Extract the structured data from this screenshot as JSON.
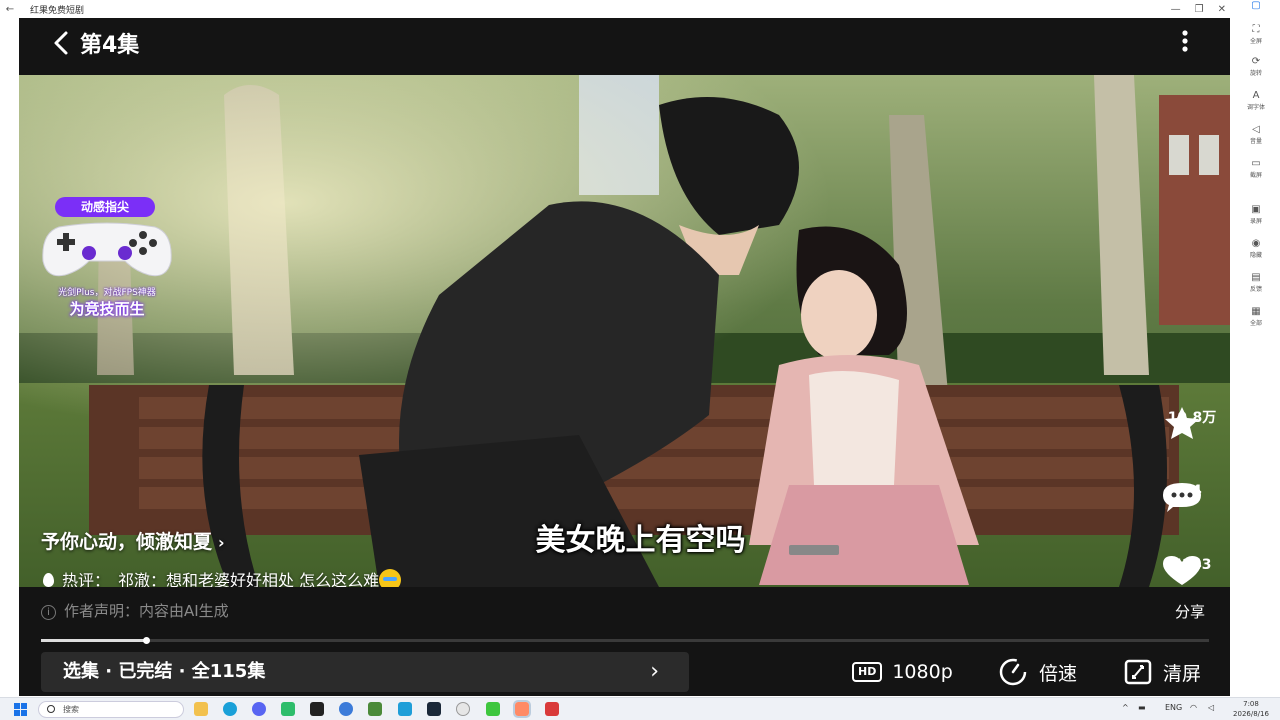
{
  "window": {
    "title": "红果免费短剧",
    "back_glyph": "←"
  },
  "side_toolbar": [
    {
      "label": "全屏",
      "icon": "fullscreen-icon"
    },
    {
      "label": "旋转",
      "icon": "rotate-icon"
    },
    {
      "label": "调字体",
      "icon": "font-icon"
    },
    {
      "label": "音量",
      "icon": "volume-icon"
    },
    {
      "label": "截屏",
      "icon": "screenshot-icon"
    },
    {
      "label": "录屏",
      "icon": "record-icon"
    },
    {
      "label": "隐藏",
      "icon": "hide-icon"
    },
    {
      "label": "反馈",
      "icon": "feedback-icon"
    },
    {
      "label": "全部",
      "icon": "all-icon"
    }
  ],
  "header": {
    "episode_title": "第4集"
  },
  "ad_badge": {
    "tag": "动感指尖",
    "line1": "光剑Plus，对战FPS神器",
    "line2": "为竞技而生"
  },
  "video": {
    "series_name": "予你心动，倾澈知夏",
    "series_chevron": "›",
    "hot_label": "热评：",
    "hot_comment": "祁澈：想和老婆好好相处 怎么这么难",
    "subtitle": "美女晚上有空吗"
  },
  "actions": {
    "favorite_count": "19.8万",
    "comment_count": "74",
    "like_count": "4243",
    "share_label": "分享"
  },
  "disclaimer": "作者声明：内容由AI生成",
  "playback": {
    "progress": 0.09
  },
  "episodes_bar": {
    "label": "选集 · 已完结 · 全115集",
    "arrow": "›"
  },
  "controls": {
    "hd_badge": "HD",
    "quality": "1080p",
    "speed": "倍速",
    "clear_screen": "清屏"
  },
  "taskbar": {
    "search_placeholder": "搜索",
    "lang": "ENG",
    "time": "7:08",
    "date": "2026/8/16"
  },
  "colors": {
    "badge_purple": "#7b2ff7",
    "player_bg": "#141414",
    "episodes_bg": "#2b2b2b"
  }
}
